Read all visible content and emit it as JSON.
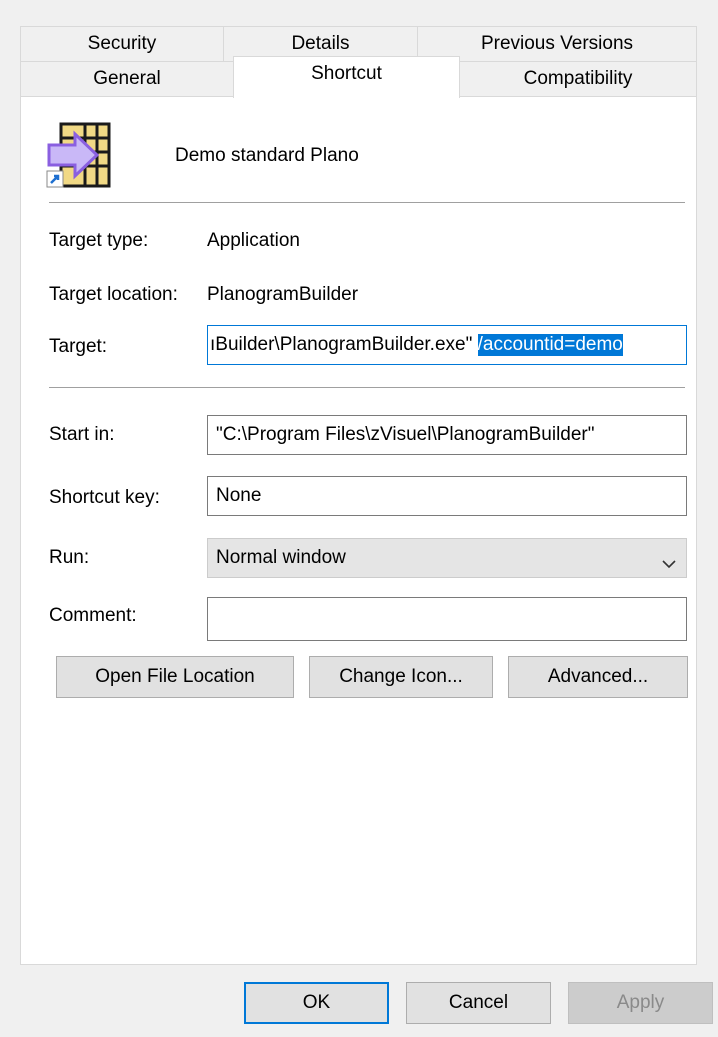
{
  "tabs_row1": [
    {
      "label": "Security"
    },
    {
      "label": "Details"
    },
    {
      "label": "Previous Versions"
    }
  ],
  "tabs_row2": [
    {
      "label": "General"
    },
    {
      "label": "Shortcut"
    },
    {
      "label": "Compatibility"
    }
  ],
  "header": {
    "name": "Demo standard Plano",
    "icon": "planogram-shortcut-icon"
  },
  "fields": {
    "target_type_label": "Target type:",
    "target_type_value": "Application",
    "target_location_label": "Target location:",
    "target_location_value": "PlanogramBuilder",
    "target_label": "Target:",
    "target_value_plain": "ıBuilder\\PlanogramBuilder.exe\" ",
    "target_value_selected": "/accountid=demo",
    "start_in_label": "Start in:",
    "start_in_value": "\"C:\\Program Files\\zVisuel\\PlanogramBuilder\"",
    "shortcut_key_label": "Shortcut key:",
    "shortcut_key_value": "None",
    "run_label": "Run:",
    "run_value": "Normal window",
    "comment_label": "Comment:",
    "comment_value": ""
  },
  "buttons": {
    "open_file_location": "Open File Location",
    "change_icon": "Change Icon...",
    "advanced": "Advanced..."
  },
  "dialog_buttons": {
    "ok": "OK",
    "cancel": "Cancel",
    "apply": "Apply"
  },
  "colors": {
    "selection": "#0078d7",
    "focus_border": "#0078d7"
  }
}
